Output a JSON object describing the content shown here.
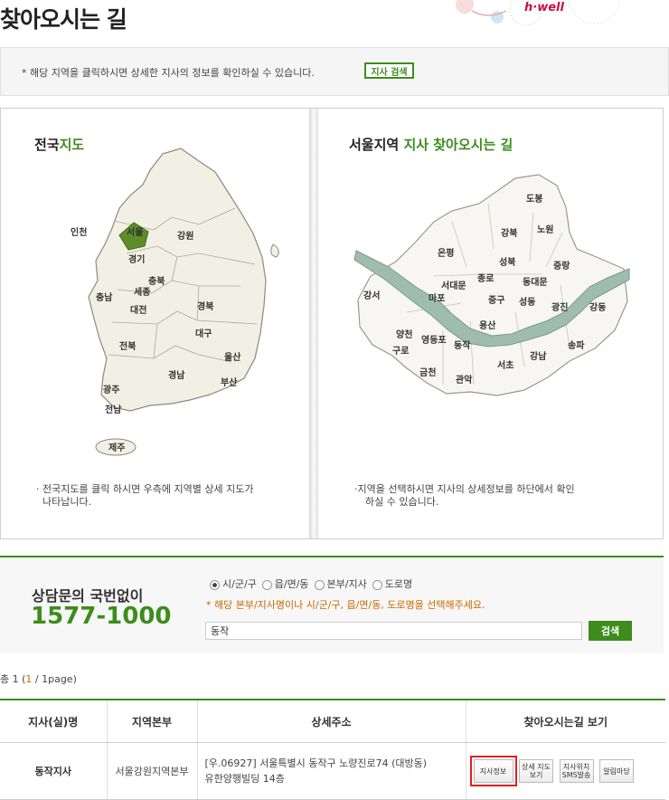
{
  "page": {
    "title": "찾아오시는 길"
  },
  "logo": {
    "text": "h·well"
  },
  "info": {
    "text": "* 해당 지역을 클릭하시면 상세한 지사의 정보를 확인하실 수 있습니다.",
    "button": "지사 검색"
  },
  "left_panel": {
    "title_plain": "전국",
    "title_hl": "지도",
    "regions": [
      "인천",
      "서울",
      "강원",
      "경기",
      "충북",
      "충남",
      "세종",
      "대전",
      "경북",
      "전북",
      "대구",
      "울산",
      "경남",
      "부산",
      "광주",
      "전남",
      "제주"
    ],
    "note_line1": "· 전국지도를 클릭 하시면 우측에 지역별 상세 지도가",
    "note_line2": "나타납니다."
  },
  "right_panel": {
    "title_plain": "서울지역 ",
    "title_hl": "지사 찾아오시는 길",
    "districts": [
      "도봉",
      "강북",
      "노원",
      "은평",
      "성북",
      "중랑",
      "종로",
      "동대문",
      "서대문",
      "강서",
      "마포",
      "중구",
      "성동",
      "광진",
      "강동",
      "용산",
      "양천",
      "영등포",
      "동작",
      "구로",
      "송파",
      "강남",
      "서초",
      "금천",
      "관악"
    ],
    "note_line1": "·지역을 선택하시면 지사의 상세정보를 하단에서 확인",
    "note_line2": "하실 수 있습니다."
  },
  "consult": {
    "label": "상담문의 국번없이",
    "phone": "1577-1000"
  },
  "search": {
    "options": [
      "시/군/구",
      "읍/면/동",
      "본부/지사",
      "도로명"
    ],
    "selected": "시/군/구",
    "hint": "* 해당 본부/지사명이나 시/군/구, 읍/면/동, 도로명을 선택해주세요.",
    "value": "동작",
    "button": "검색"
  },
  "result": {
    "total_prefix": "총 1 (",
    "current_page": "1",
    "total_suffix": " / 1page)",
    "headers": [
      "지사(실)명",
      "지역본부",
      "상세주소",
      "찾아오시는길 보기"
    ],
    "rows": [
      {
        "name": "동작지사",
        "hq": "서울강원지역본부",
        "address_line1": "[우.06927] 서울특별시 동작구 노량진로74 (대방동)",
        "address_line2": "유한양행빌딩 14층",
        "buttons": [
          "지사정보",
          "상세 지도보기",
          "지사위치 SMS발송",
          "알림마당"
        ]
      }
    ]
  },
  "colors": {
    "accent": "#3d8c1c",
    "highlight": "#c96a00",
    "selected_outline": "#e02020"
  }
}
